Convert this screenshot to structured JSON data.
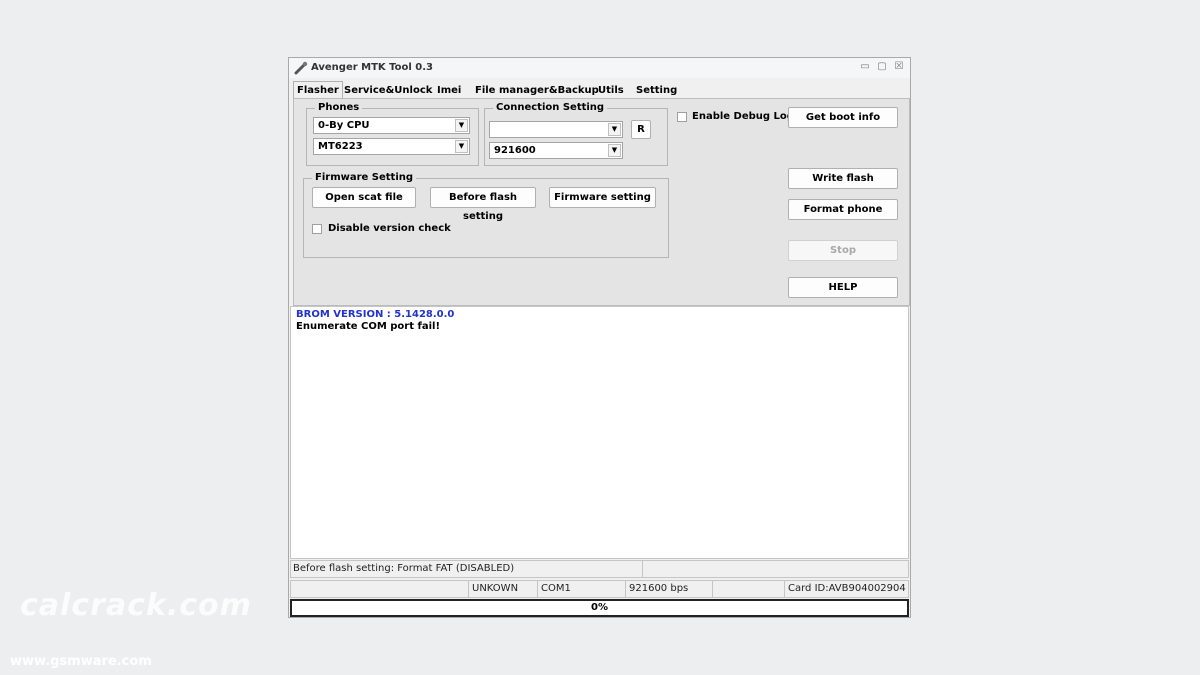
{
  "window": {
    "title": "Avenger MTK Tool 0.3",
    "controls": {
      "minimize": "▭",
      "maximize": "▢",
      "close": "☒"
    }
  },
  "tabs": [
    "Flasher",
    "Service&Unlock",
    "Imei",
    "File manager&Backup",
    "Utils",
    "Setting"
  ],
  "active_tab": "Flasher",
  "phones": {
    "legend": "Phones",
    "cpu_value": "0-By CPU",
    "model_value": "MT6223"
  },
  "connection": {
    "legend": "Connection Setting",
    "port_value": "",
    "baud_value": "921600",
    "refresh_label": "R"
  },
  "debug_log": {
    "label": "Enable Debug Log",
    "checked": false
  },
  "buttons": {
    "get_boot_info": "Get boot info",
    "write_flash": "Write flash",
    "format_phone": "Format phone",
    "stop": "Stop",
    "help": "HELP"
  },
  "firmware": {
    "legend": "Firmware Setting",
    "open_scat": "Open scat file",
    "before_flash": "Before flash setting",
    "firmware_setting": "Firmware setting",
    "disable_version_check": "Disable version check"
  },
  "log": {
    "line1": "BROM VERSION : 5.1428.0.0",
    "line2": "Enumerate COM port fail!"
  },
  "status": {
    "message": "Before flash setting: Format FAT (DISABLED)",
    "state": "UNKOWN",
    "port": "COM1",
    "baud": "921600 bps",
    "card_id": "Card ID:AVB904002904"
  },
  "progress": {
    "value": 0,
    "label": "0%"
  },
  "watermarks": {
    "site1": "calcrack.com",
    "site2": "www.gsmware.com"
  },
  "colors": {
    "log_highlight": "#2233cc",
    "progress_fill": "#3c8dde"
  }
}
